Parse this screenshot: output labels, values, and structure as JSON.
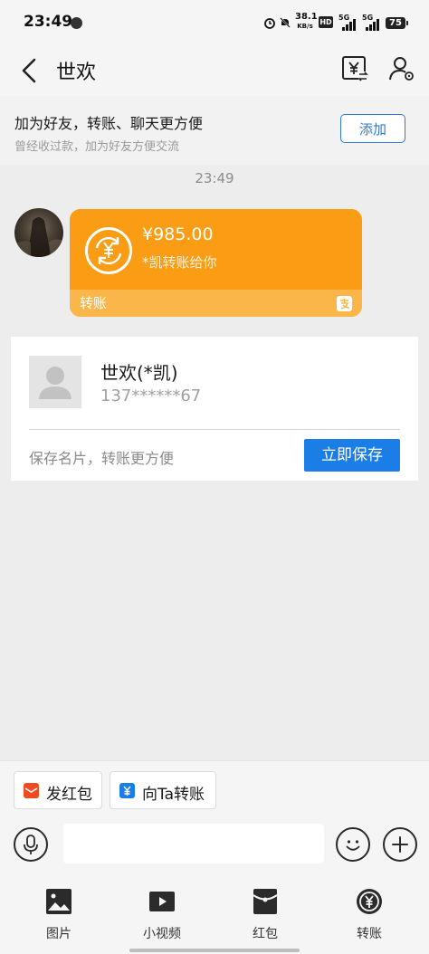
{
  "status_bar": {
    "time": "23:49",
    "net_speed_value": "38.1",
    "net_speed_unit": "KB/s",
    "hd_badge": "HD",
    "signal_1": "5G",
    "signal_2": "5G",
    "battery": "75"
  },
  "header": {
    "title": "世欢"
  },
  "add_friend_banner": {
    "title": "加为好友，转账、聊天更方便",
    "subtitle": "曾经收过款，加为好友方便交流",
    "button_label": "添加"
  },
  "conversation": {
    "timestamp": "23:49",
    "transfer": {
      "amount": "¥985.00",
      "note": "*凯转账给你",
      "label": "转账"
    }
  },
  "contact_card": {
    "name": "世欢(*凯)",
    "phone": "137******67",
    "hint": "保存名片，转账更方便",
    "save_button": "立即保存"
  },
  "quick_actions": {
    "red_packet": "发红包",
    "transfer": "向Ta转账"
  },
  "composer": {
    "placeholder": "",
    "value": ""
  },
  "toolbar": {
    "photo": "图片",
    "video": "小视频",
    "red_packet": "红包",
    "transfer": "转账"
  },
  "colors": {
    "transfer_card": "#fa9d14",
    "transfer_card_footer": "#fbb649",
    "primary_blue": "#1a7ee6",
    "red_packet": "#f04a22"
  }
}
